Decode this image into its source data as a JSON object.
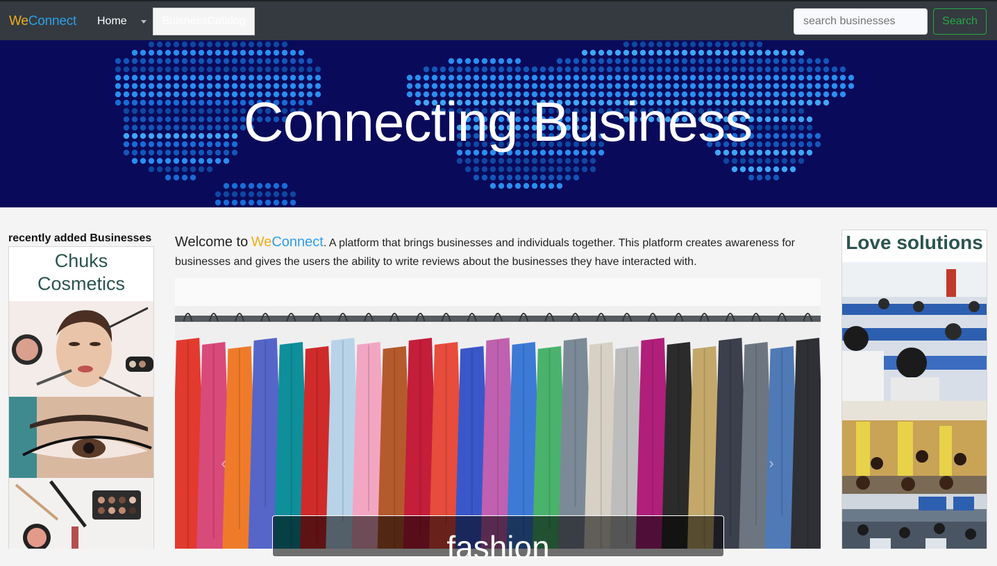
{
  "navbar": {
    "brand_we": "We",
    "brand_connect": "Connect",
    "home_label": "Home",
    "catalog_label": "BuisnessCatalog",
    "search_placeholder": "search businesses",
    "search_button": "Search"
  },
  "hero": {
    "title": "Connecting Business"
  },
  "sidebar_left": {
    "heading": "recently added Businesses",
    "card_title": "Chuks Cosmetics",
    "images": [
      "makeup-portrait",
      "eye-makeup",
      "cosmetics-flatlay"
    ]
  },
  "main": {
    "welcome_prefix": "Welcome to",
    "welcome_we": "We",
    "welcome_connect": "Connect",
    "welcome_text": ". A platform that brings businesses and individuals together. This platform creates awareness for businesses and gives the users the ability to write reviews about the businesses they have interacted with.",
    "carousel": {
      "caption": "fashion",
      "prev_icon": "chevron-left-icon",
      "next_icon": "chevron-right-icon",
      "image": "clothes-rack"
    }
  },
  "sidebar_right": {
    "card_title": "Love solutions",
    "images": [
      "exam-hall",
      "computer-lab",
      "training-room"
    ]
  },
  "colors": {
    "navbar_bg": "#343a40",
    "brand_orange": "#f0ad1c",
    "brand_blue": "#2f9ee8",
    "search_green": "#28a745",
    "hero_bg": "#0a0a5a",
    "card_title": "#2b5450"
  }
}
